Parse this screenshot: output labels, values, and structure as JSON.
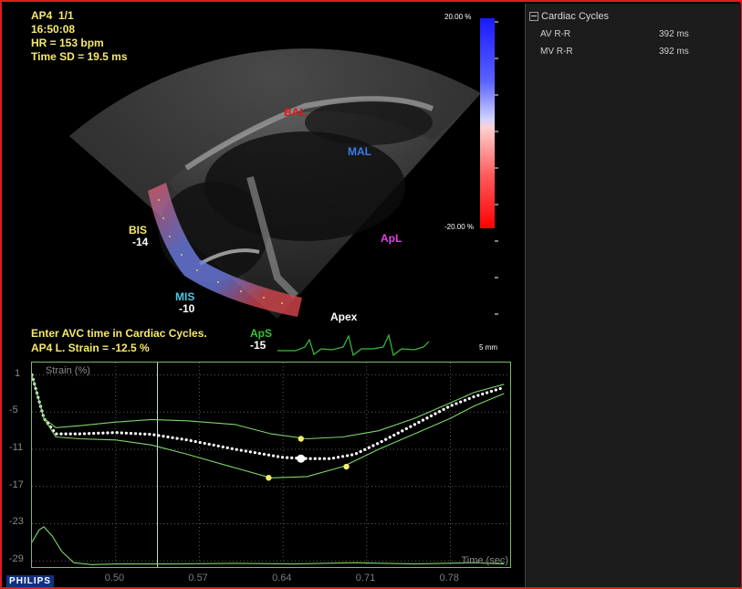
{
  "overlay": {
    "view": "AP4  1/1",
    "time": "16:50:08",
    "hr": "HR = 153 bpm",
    "time_sd": "Time SD = 19.5 ms",
    "instruction": "Enter AVC time in Cardiac Cycles.",
    "global_strain": "AP4 L. Strain = -12.5 %"
  },
  "segments": {
    "bis": {
      "name": "BIS",
      "value": "-14",
      "color": "#f7e66a"
    },
    "mis": {
      "name": "MIS",
      "value": "-10",
      "color": "#4fc9e6"
    },
    "aps": {
      "name": "ApS",
      "value": "-15",
      "color": "#35c23a"
    },
    "apex": "Apex",
    "bal": "BAL",
    "mal": "MAL",
    "apl": "ApL"
  },
  "colorbar": {
    "top": "20.00 %",
    "bottom": "-20.00 %",
    "depth": "5 mm"
  },
  "chart": {
    "ylabel": "Strain (%)",
    "xlabel": "Time (sec)"
  },
  "chart_data": {
    "type": "line",
    "ylabel": "Strain (%)",
    "xlabel": "Time (sec)",
    "xlim": [
      0.43,
      0.83
    ],
    "ylim": [
      -30,
      3
    ],
    "x_ticks": [
      "0.50",
      "0.57",
      "0.64",
      "0.71",
      "0.78"
    ],
    "y_ticks": [
      "1",
      "-5",
      "-11",
      "-17",
      "-23",
      "-29"
    ],
    "avc_marker_x": 0.535,
    "series": [
      {
        "color": "#ffffff",
        "style": "dotted",
        "x": [
          0.43,
          0.44,
          0.45,
          0.47,
          0.5,
          0.53,
          0.56,
          0.6,
          0.64,
          0.66,
          0.68,
          0.7,
          0.72,
          0.75,
          0.78,
          0.8,
          0.825
        ],
        "y": [
          1,
          -6,
          -8.5,
          -8.5,
          -8.3,
          -8.6,
          -9.5,
          -11,
          -12.3,
          -12.5,
          -12.5,
          -11.8,
          -10,
          -7,
          -4,
          -2.5,
          -1
        ]
      },
      {
        "color": "#7fd46a",
        "style": "solid",
        "x": [
          0.43,
          0.44,
          0.45,
          0.47,
          0.5,
          0.53,
          0.56,
          0.6,
          0.63,
          0.66,
          0.69,
          0.72,
          0.75,
          0.78,
          0.8,
          0.825
        ],
        "y": [
          1,
          -6,
          -7.5,
          -7.2,
          -6.6,
          -6.2,
          -6.4,
          -7,
          -8.5,
          -9.3,
          -9,
          -8,
          -6,
          -3.5,
          -1.8,
          -0.5
        ]
      },
      {
        "color": "#7fd46a",
        "style": "solid",
        "x": [
          0.43,
          0.44,
          0.45,
          0.47,
          0.5,
          0.53,
          0.56,
          0.6,
          0.63,
          0.66,
          0.69,
          0.72,
          0.75,
          0.78,
          0.8,
          0.825
        ],
        "y": [
          1,
          -6,
          -9,
          -9.3,
          -9.5,
          -10.3,
          -11.8,
          -14,
          -15.6,
          -15.4,
          -13.8,
          -11,
          -8.5,
          -6,
          -4,
          -2
        ]
      },
      {
        "color": "#7fd46a",
        "style": "solid",
        "x": [
          0.43,
          0.436,
          0.44,
          0.447,
          0.455,
          0.465,
          0.48,
          0.5,
          0.55,
          0.6,
          0.65,
          0.7,
          0.75,
          0.8,
          0.825
        ],
        "y": [
          -26,
          -24,
          -23.5,
          -25,
          -27.5,
          -29.3,
          -29.6,
          -29.5,
          -29.5,
          -29.4,
          -29.5,
          -29.3,
          -29.5,
          -29.3,
          -29.5
        ]
      }
    ],
    "markers": [
      {
        "x": 0.655,
        "y": -9.3,
        "color": "#f5ef6a"
      },
      {
        "x": 0.655,
        "y": -12.5,
        "color": "#ffffff"
      },
      {
        "x": 0.628,
        "y": -15.6,
        "color": "#f5ef6a"
      },
      {
        "x": 0.693,
        "y": -13.8,
        "color": "#f5ef6a"
      }
    ]
  },
  "sidebar": {
    "title": "Cardiac Cycles",
    "rows": [
      {
        "label": "AV R-R",
        "value": "392 ms"
      },
      {
        "label": "MV R-R",
        "value": "392 ms"
      }
    ]
  },
  "brand": "PHILIPS"
}
